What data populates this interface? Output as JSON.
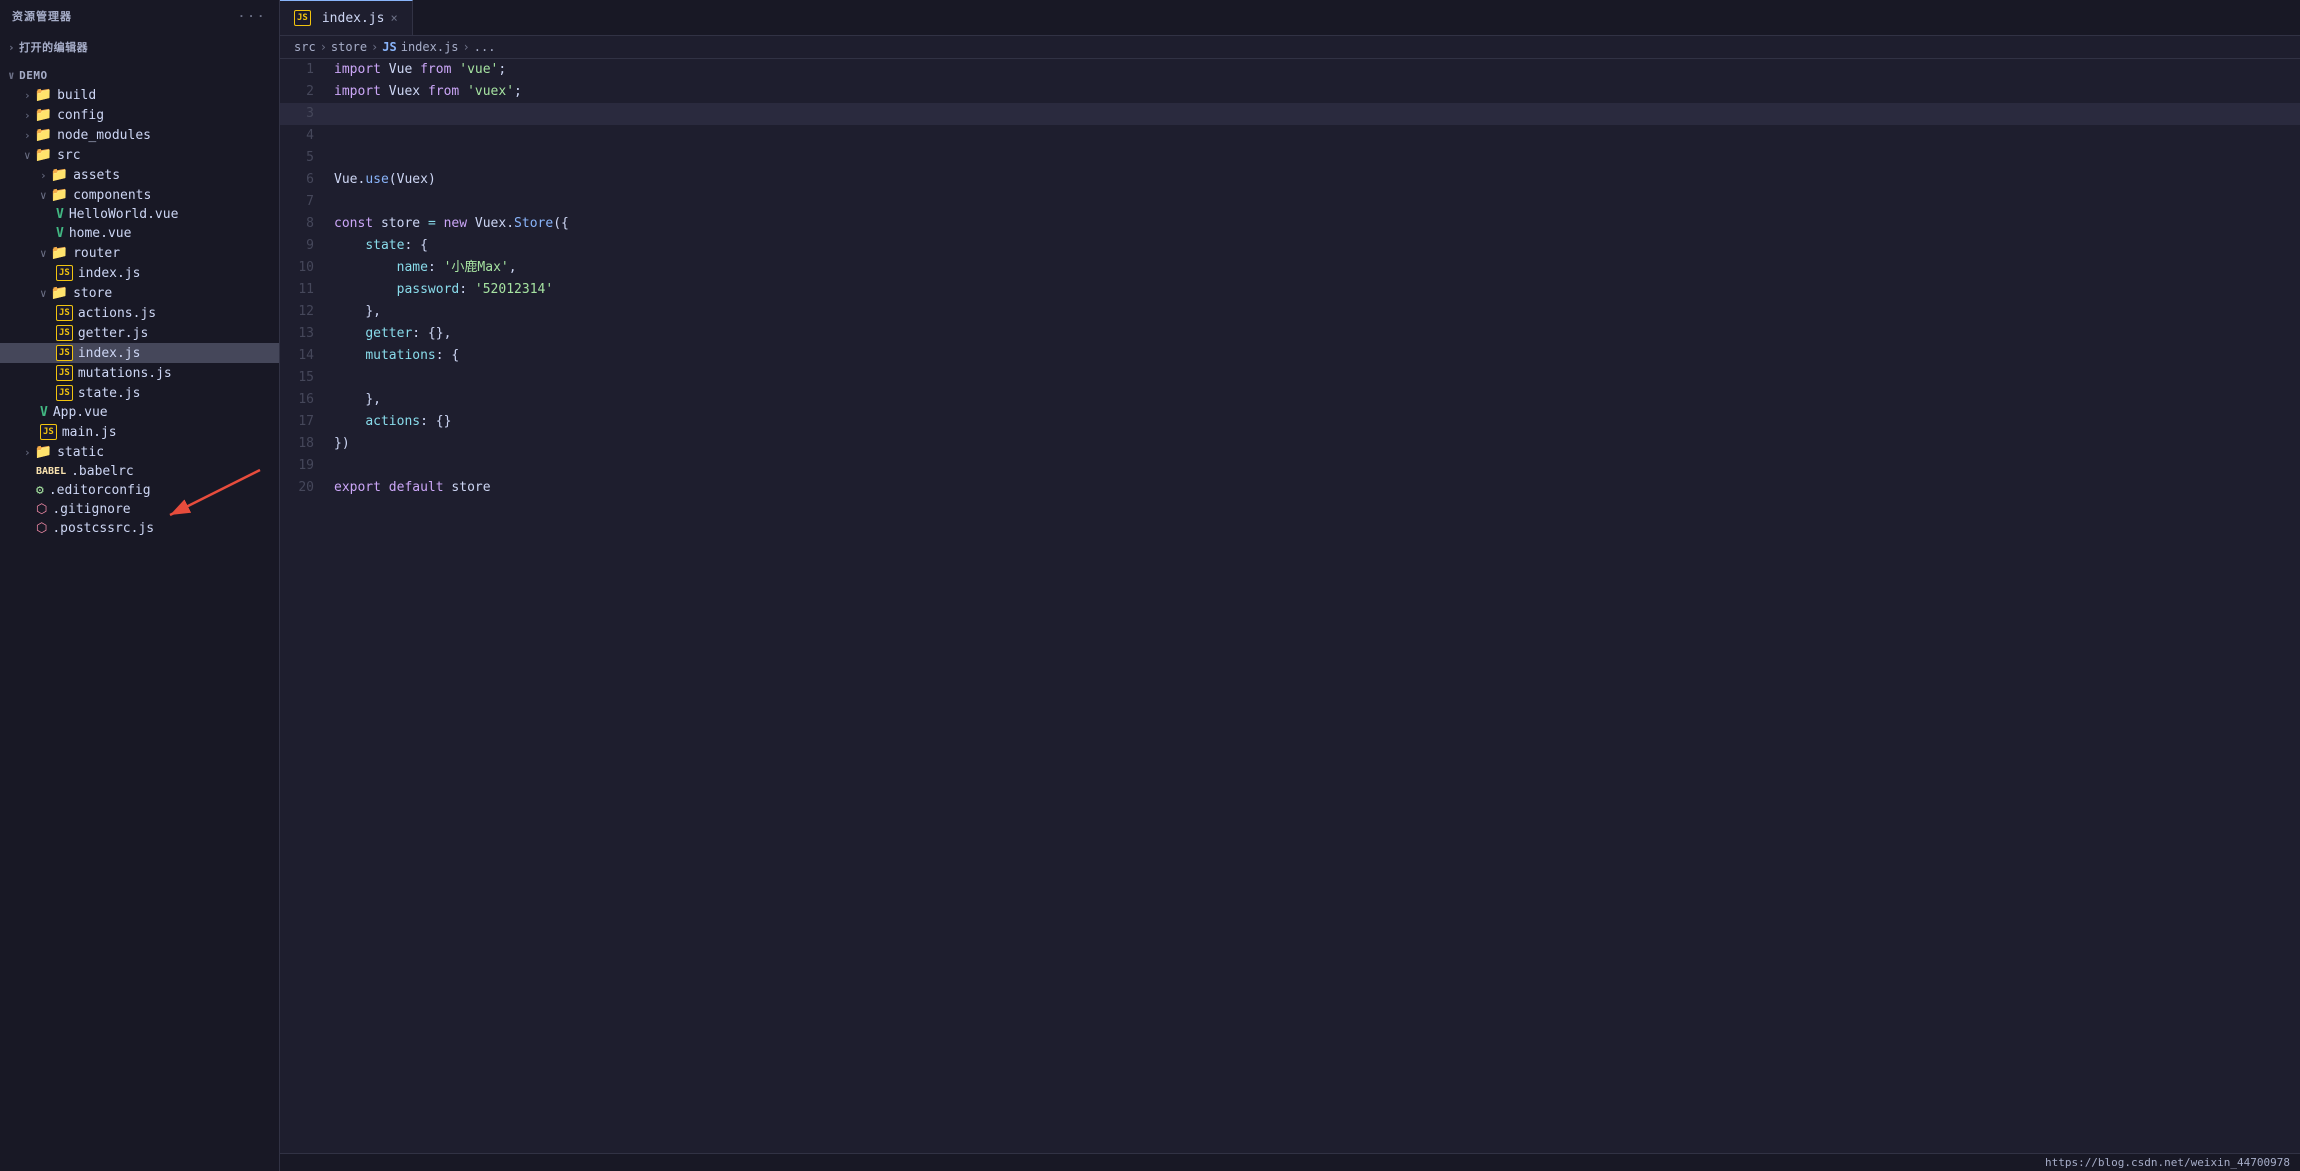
{
  "sidebar": {
    "title": "资源管理器",
    "dots": "···",
    "open_editors": "打开的编辑器",
    "demo": "DEMO",
    "items": [
      {
        "id": "build",
        "label": "build",
        "type": "folder",
        "indent": 1,
        "collapsed": true
      },
      {
        "id": "config",
        "label": "config",
        "type": "folder",
        "indent": 1,
        "collapsed": true
      },
      {
        "id": "node_modules",
        "label": "node_modules",
        "type": "folder",
        "indent": 1,
        "collapsed": true
      },
      {
        "id": "src",
        "label": "src",
        "type": "folder",
        "indent": 1,
        "collapsed": false
      },
      {
        "id": "assets",
        "label": "assets",
        "type": "folder",
        "indent": 2,
        "collapsed": true
      },
      {
        "id": "components",
        "label": "components",
        "type": "folder",
        "indent": 2,
        "collapsed": false
      },
      {
        "id": "HelloWorld.vue",
        "label": "HelloWorld.vue",
        "type": "vue",
        "indent": 3
      },
      {
        "id": "home.vue",
        "label": "home.vue",
        "type": "vue",
        "indent": 3
      },
      {
        "id": "router",
        "label": "router",
        "type": "folder",
        "indent": 2,
        "collapsed": false
      },
      {
        "id": "router_index.js",
        "label": "index.js",
        "type": "js",
        "indent": 3
      },
      {
        "id": "store",
        "label": "store",
        "type": "folder",
        "indent": 2,
        "collapsed": false
      },
      {
        "id": "actions.js",
        "label": "actions.js",
        "type": "js",
        "indent": 3
      },
      {
        "id": "getter.js",
        "label": "getter.js",
        "type": "js",
        "indent": 3
      },
      {
        "id": "store_index.js",
        "label": "index.js",
        "type": "js",
        "indent": 3,
        "active": true
      },
      {
        "id": "mutations.js",
        "label": "mutations.js",
        "type": "js",
        "indent": 3
      },
      {
        "id": "state.js",
        "label": "state.js",
        "type": "js",
        "indent": 3
      },
      {
        "id": "App.vue",
        "label": "App.vue",
        "type": "vue",
        "indent": 2
      },
      {
        "id": "main.js",
        "label": "main.js",
        "type": "js",
        "indent": 2
      },
      {
        "id": "static",
        "label": "static",
        "type": "folder",
        "indent": 1,
        "collapsed": true
      },
      {
        "id": ".babelrc",
        "label": ".babelrc",
        "type": "babelrc",
        "indent": 1
      },
      {
        "id": ".editorconfig",
        "label": ".editorconfig",
        "type": "editorconfig",
        "indent": 1
      },
      {
        "id": ".gitignore",
        "label": ".gitignore",
        "type": "gitignore",
        "indent": 1
      },
      {
        "id": ".postcssrc.js",
        "label": ".postcssrc.js",
        "type": "postcss",
        "indent": 1
      }
    ]
  },
  "tab": {
    "label": "index.js",
    "close_label": "×"
  },
  "breadcrumb": {
    "parts": [
      "src",
      ">",
      "store",
      ">",
      "JS index.js",
      ">",
      "..."
    ]
  },
  "code": {
    "lines": [
      {
        "n": 1,
        "content": "import Vue from 'vue';"
      },
      {
        "n": 2,
        "content": "import Vuex from 'vuex';"
      },
      {
        "n": 3,
        "content": ""
      },
      {
        "n": 4,
        "content": ""
      },
      {
        "n": 5,
        "content": ""
      },
      {
        "n": 6,
        "content": "Vue.use(Vuex)"
      },
      {
        "n": 7,
        "content": ""
      },
      {
        "n": 8,
        "content": "const store = new Vuex.Store({"
      },
      {
        "n": 9,
        "content": "    state: {"
      },
      {
        "n": 10,
        "content": "        name: '小鹿Max',"
      },
      {
        "n": 11,
        "content": "        password: '52012314'"
      },
      {
        "n": 12,
        "content": "    },"
      },
      {
        "n": 13,
        "content": "    getter: {},"
      },
      {
        "n": 14,
        "content": "    mutations: {"
      },
      {
        "n": 15,
        "content": ""
      },
      {
        "n": 16,
        "content": "    },"
      },
      {
        "n": 17,
        "content": "    actions: {}"
      },
      {
        "n": 18,
        "content": "})"
      },
      {
        "n": 19,
        "content": ""
      },
      {
        "n": 20,
        "content": "export default store"
      }
    ]
  },
  "status_bar": {
    "url": "https://blog.csdn.net/weixin_44700978"
  }
}
